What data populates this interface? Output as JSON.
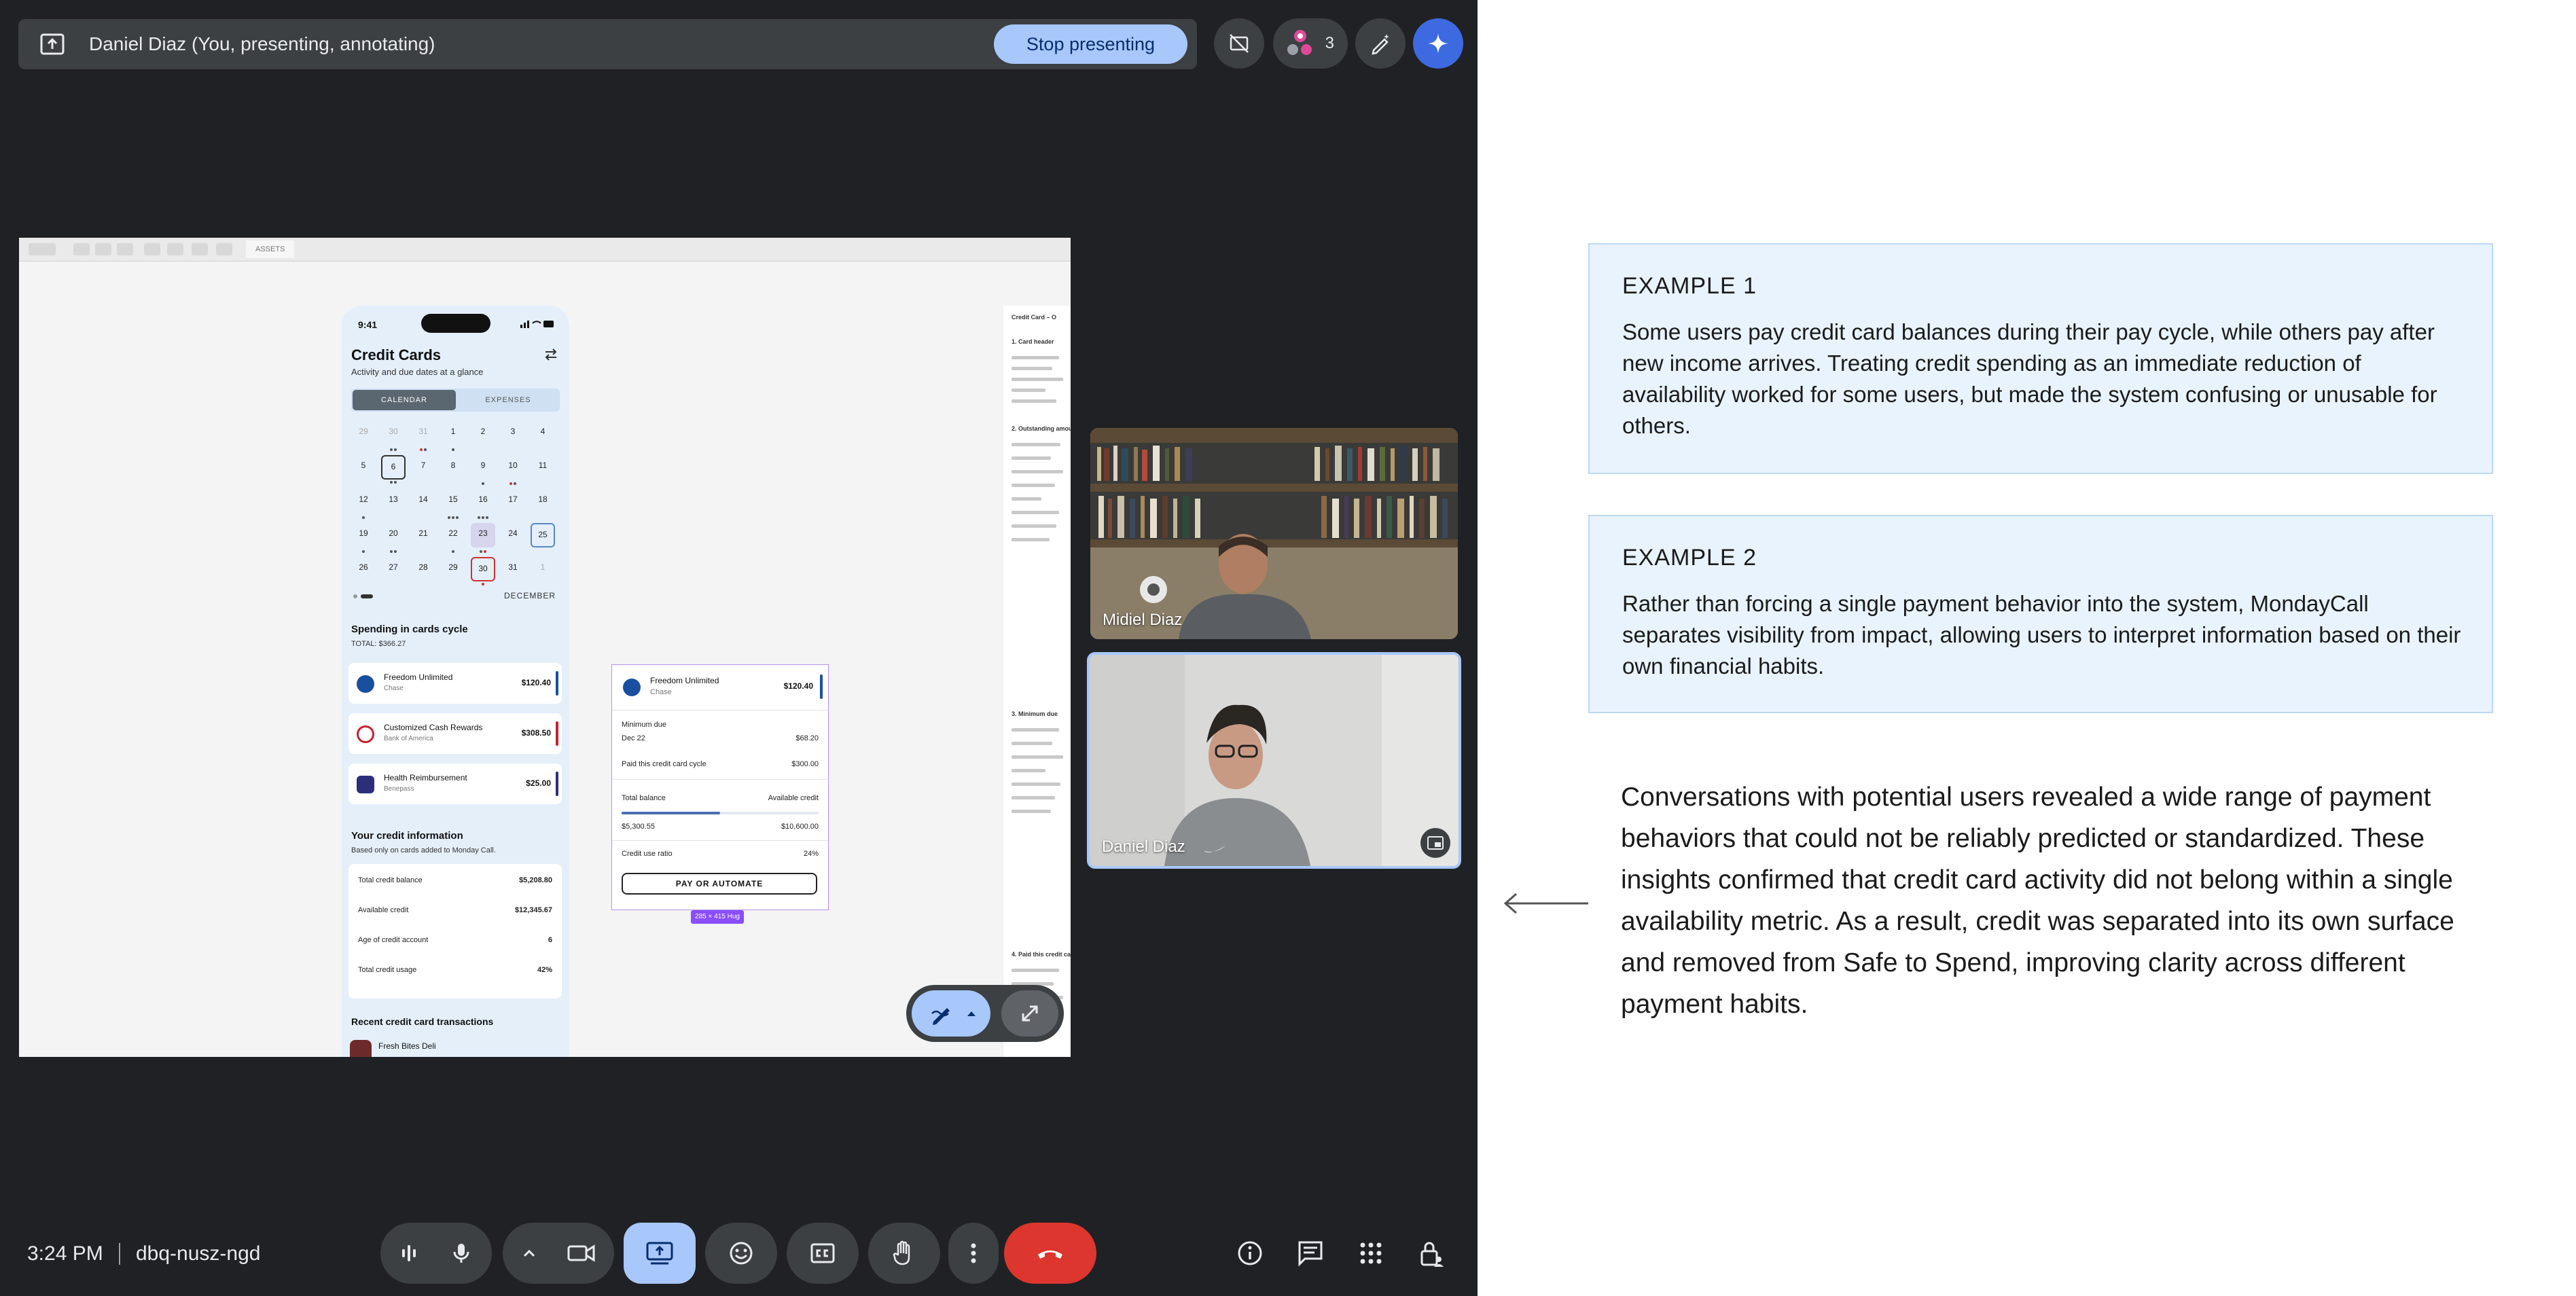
{
  "meet": {
    "presenting_label": "Daniel Diaz (You, presenting, annotating)",
    "stop_label": "Stop presenting",
    "people_count": "3",
    "clock": "3:24 PM",
    "meeting_code": "dbq-nusz-ngd",
    "tiles": [
      {
        "name": "Midiel Diaz"
      },
      {
        "name": "Daniel Diaz"
      }
    ]
  },
  "shared_screen": {
    "toolbar_tab": "ASSETS",
    "phone": {
      "time": "9:41",
      "title": "Credit Cards",
      "subtitle": "Activity and due dates at a glance",
      "segments": [
        "CALENDAR",
        "EXPENSES"
      ],
      "calendar_rows": [
        [
          "29",
          "30",
          "31",
          "1",
          "2",
          "3",
          "4"
        ],
        [
          "5",
          "6",
          "7",
          "8",
          "9",
          "10",
          "11"
        ],
        [
          "12",
          "13",
          "14",
          "15",
          "16",
          "17",
          "18"
        ],
        [
          "19",
          "20",
          "21",
          "22",
          "23",
          "24",
          "25"
        ],
        [
          "26",
          "27",
          "28",
          "29",
          "30",
          "31",
          "1"
        ]
      ],
      "month": "DECEMBER",
      "spending_title": "Spending in cards cycle",
      "spending_total": "TOTAL: $366.27",
      "cards": [
        {
          "name": "Freedom Unlimited",
          "bank": "Chase",
          "amount": "$120.40",
          "color": "#1a4fa0"
        },
        {
          "name": "Customized Cash Rewards",
          "bank": "Bank of America",
          "amount": "$308.50",
          "color": "#c8202f"
        },
        {
          "name": "Health Reimbursement",
          "bank": "Benepass",
          "amount": "$25.00",
          "color": "#2b2f7a"
        }
      ],
      "credit_title": "Your credit information",
      "credit_sub": "Based only on cards added to Monday Call.",
      "credit_rows": [
        {
          "label": "Total credit balance",
          "value": "$5,208.80"
        },
        {
          "label": "Available credit",
          "value": "$12,345.67"
        },
        {
          "label": "Age of credit account",
          "value": "6"
        },
        {
          "label": "Total credit usage",
          "value": "42%"
        }
      ],
      "recent_title": "Recent credit card transactions",
      "recent_item": "Fresh Bites Deli"
    },
    "component": {
      "name": "Freedom Unlimited",
      "bank": "Chase",
      "amount": "$120.40",
      "min_due_label": "Minimum due",
      "min_due_date": "Dec 22",
      "min_due_value": "$68.20",
      "paid_label": "Paid this credit card cycle",
      "paid_value": "$300.00",
      "balance_label": "Total balance",
      "available_label": "Available credit",
      "balance_value": "$5,300.55",
      "available_value": "$10,600.00",
      "usage_fraction": 0.5,
      "ratio_label": "Credit use ratio",
      "ratio_value": "24%",
      "button": "PAY OR AUTOMATE",
      "size_label": "285 × 415 Hug"
    },
    "doc_panel": {
      "title": "Credit Card – O",
      "lines": [
        "1. Card header",
        "2. Outstanding amou",
        "3. Minimum due",
        "4. Paid this credit ca"
      ]
    }
  },
  "notes": {
    "example1_title": "EXAMPLE 1",
    "example1_body": "Some users pay credit card balances during their pay cycle, while others pay after new income arrives. Treating credit spending as an immediate reduction of availability worked for some users, but made the system confusing or unusable for others.",
    "example2_title": "EXAMPLE 2",
    "example2_body": "Rather than forcing a single payment behavior into the system, MondayCall separates visibility from impact, allowing users to interpret information based on their own financial habits.",
    "narrative": "Conversations with potential users revealed a wide range of payment behaviors that could not be reliably predicted or standardized. These insights confirmed that credit card activity did not belong within a single availability metric. As a result, credit was separated into its own surface and removed from Safe to Spend, improving clarity across different payment habits."
  },
  "colors": {
    "meet_bg": "#202124",
    "stop_button": "#a8c7fa",
    "end_call": "#ea4335",
    "note_box": "#e8f3fd"
  }
}
